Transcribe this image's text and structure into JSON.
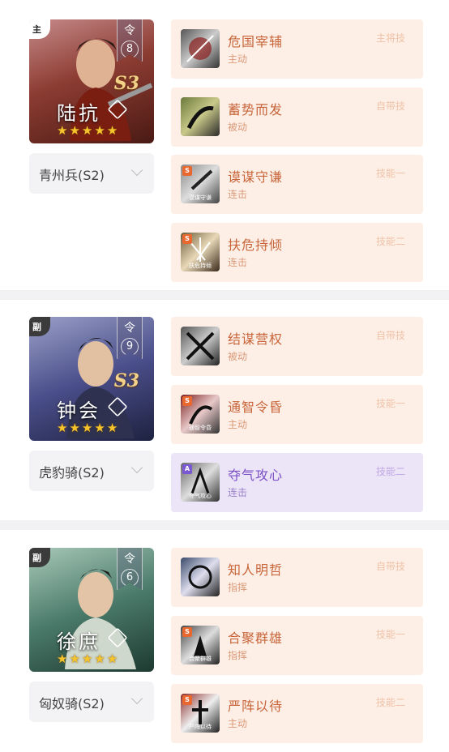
{
  "generals": [
    {
      "role": "主",
      "ling": "令",
      "ling_num": "8",
      "season": "S3",
      "name": "陆抗",
      "troop": "青州兵(S2)",
      "skills": [
        {
          "name": "危国宰辅",
          "type": "主动",
          "slot": "主将技",
          "grade": "",
          "calli": ""
        },
        {
          "name": "蓄势而发",
          "type": "被动",
          "slot": "自带技",
          "grade": "",
          "calli": ""
        },
        {
          "name": "谟谋守谦",
          "type": "连击",
          "slot": "技能一",
          "grade": "S",
          "calli": "谟谋守谦"
        },
        {
          "name": "扶危持倾",
          "type": "连击",
          "slot": "技能二",
          "grade": "S",
          "calli": "扶危持倾"
        }
      ]
    },
    {
      "role": "副",
      "ling": "令",
      "ling_num": "9",
      "season": "S3",
      "name": "钟会",
      "troop": "虎豹骑(S2)",
      "skills": [
        {
          "name": "结谋营权",
          "type": "被动",
          "slot": "自带技",
          "grade": "",
          "calli": ""
        },
        {
          "name": "通智令昏",
          "type": "主动",
          "slot": "技能一",
          "grade": "S",
          "calli": "通智令昏"
        },
        {
          "name": "夺气攻心",
          "type": "连击",
          "slot": "技能二",
          "grade": "A",
          "calli": "夺气攻心"
        }
      ]
    },
    {
      "role": "副",
      "ling": "令",
      "ling_num": "6",
      "season": "",
      "name": "徐庶",
      "troop": "匈奴骑(S2)",
      "skills": [
        {
          "name": "知人明哲",
          "type": "指挥",
          "slot": "自带技",
          "grade": "",
          "calli": ""
        },
        {
          "name": "合聚群雄",
          "type": "指挥",
          "slot": "技能一",
          "grade": "S",
          "calli": "合聚群雄"
        },
        {
          "name": "严阵以待",
          "type": "主动",
          "slot": "技能二",
          "grade": "S",
          "calli": "严阵以待"
        }
      ]
    }
  ],
  "colors": {
    "skill_bg": "#fdefe6",
    "skill_purple_bg": "#ece4f7",
    "star": "#f5c42c"
  }
}
